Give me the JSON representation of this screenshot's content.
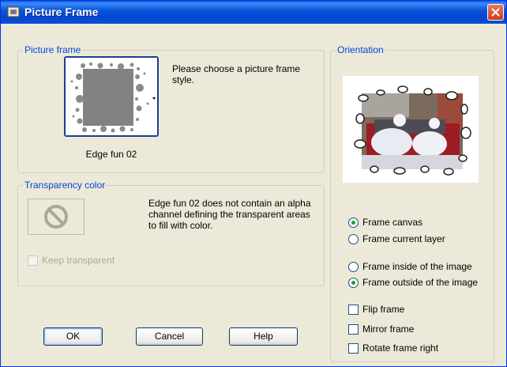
{
  "window": {
    "title": "Picture Frame"
  },
  "picture_frame": {
    "legend": "Picture frame",
    "instruction": "Please choose a picture frame style.",
    "selected_style": "Edge fun 02"
  },
  "transparency": {
    "legend": "Transparency color",
    "message": "Edge fun 02 does not contain an alpha channel defining the transparent areas to fill with color.",
    "keep_transparent_label": "Keep transparent",
    "keep_transparent_checked": false
  },
  "orientation": {
    "legend": "Orientation",
    "frame_target": {
      "options": [
        "Frame canvas",
        "Frame current layer"
      ],
      "selected": "Frame canvas"
    },
    "frame_position": {
      "options": [
        "Frame inside of the image",
        "Frame outside of the image"
      ],
      "selected": "Frame outside of the image"
    },
    "flip_frame_label": "Flip frame",
    "mirror_frame_label": "Mirror frame",
    "rotate_frame_label": "Rotate frame right"
  },
  "buttons": {
    "ok": "OK",
    "cancel": "Cancel",
    "help": "Help"
  },
  "colors": {
    "title_bar": "#0a58dd",
    "legend": "#0046d5",
    "dialog_bg": "#ece9d8",
    "close": "#c73d1a"
  }
}
